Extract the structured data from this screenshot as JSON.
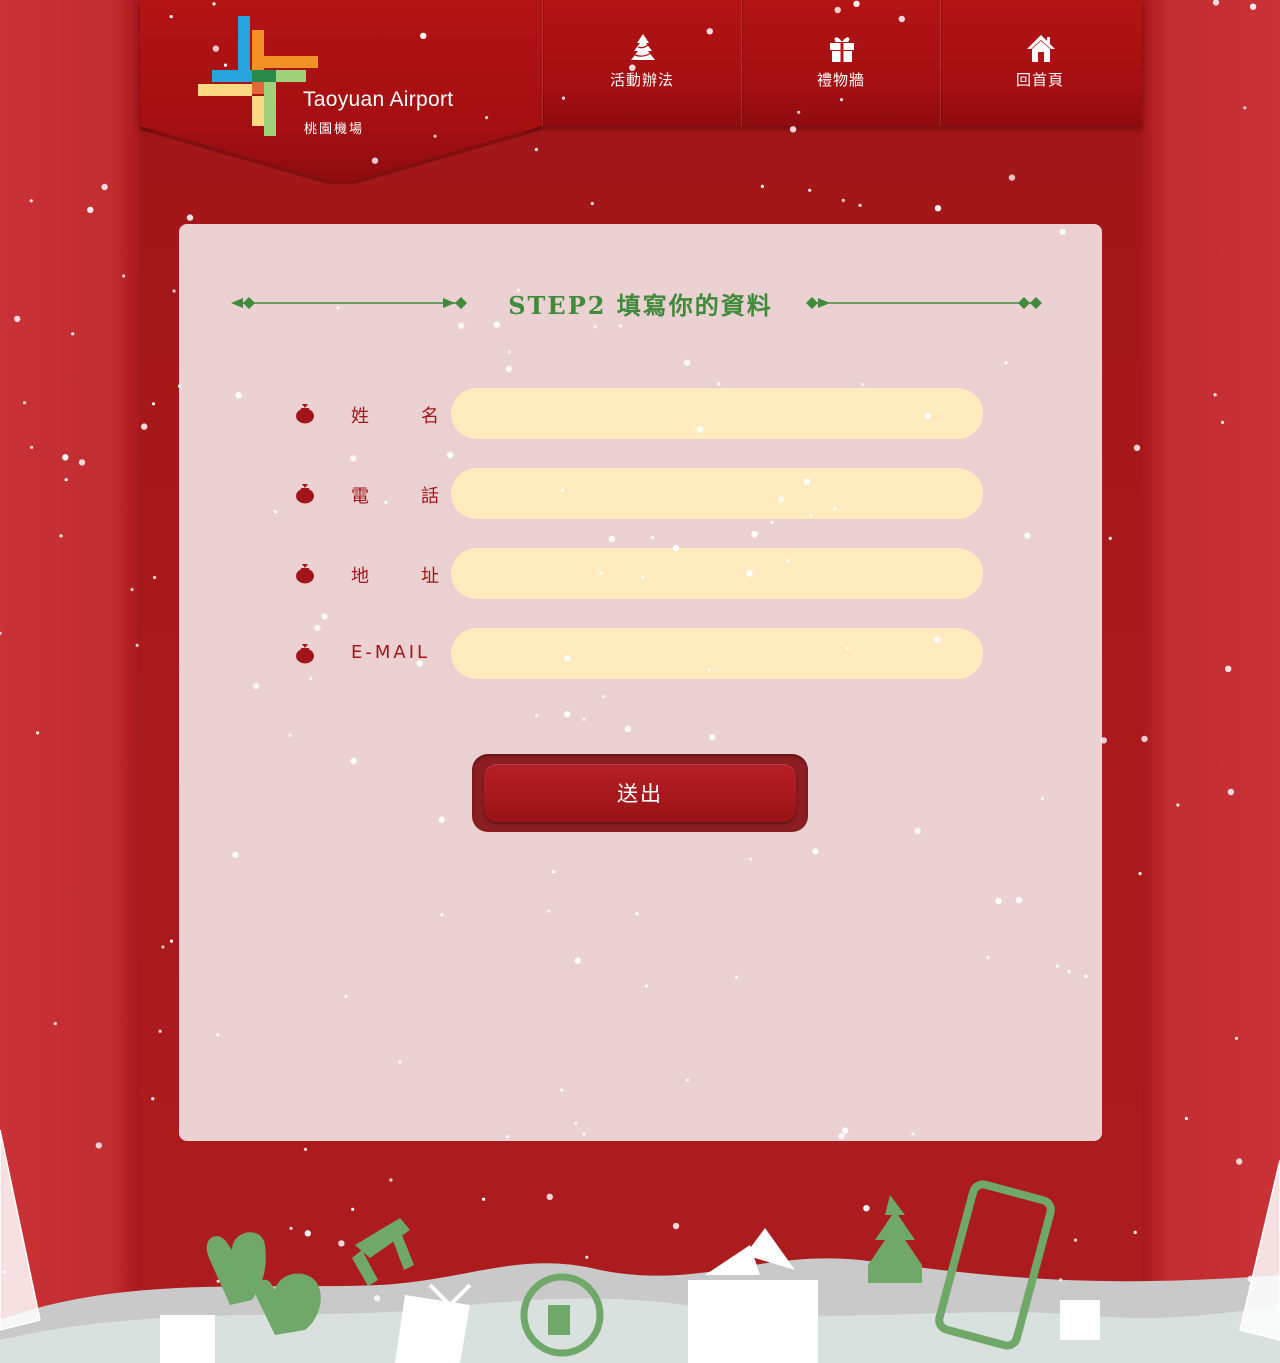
{
  "brand": {
    "name_en": "Taoyuan Airport",
    "name_zh": "桃園機場"
  },
  "nav": [
    {
      "label": "活動辦法",
      "icon": "christmas-tree-icon"
    },
    {
      "label": "禮物牆",
      "icon": "gift-icon"
    },
    {
      "label": "回首頁",
      "icon": "home-icon"
    }
  ],
  "form": {
    "title": "STEP2 填寫你的資料",
    "fields": [
      {
        "label": "姓　　名",
        "value": ""
      },
      {
        "label": "電　　話",
        "value": ""
      },
      {
        "label": "地　　址",
        "value": ""
      },
      {
        "label": "E-MAIL",
        "value": ""
      }
    ],
    "submit_label": "送出"
  },
  "colors": {
    "background": "#c62f33",
    "nav": "#a40f12",
    "panel": "#ecd1d3",
    "input": "#ffebbe",
    "accent_green": "#3f8a3b",
    "label_red": "#a3151b"
  }
}
